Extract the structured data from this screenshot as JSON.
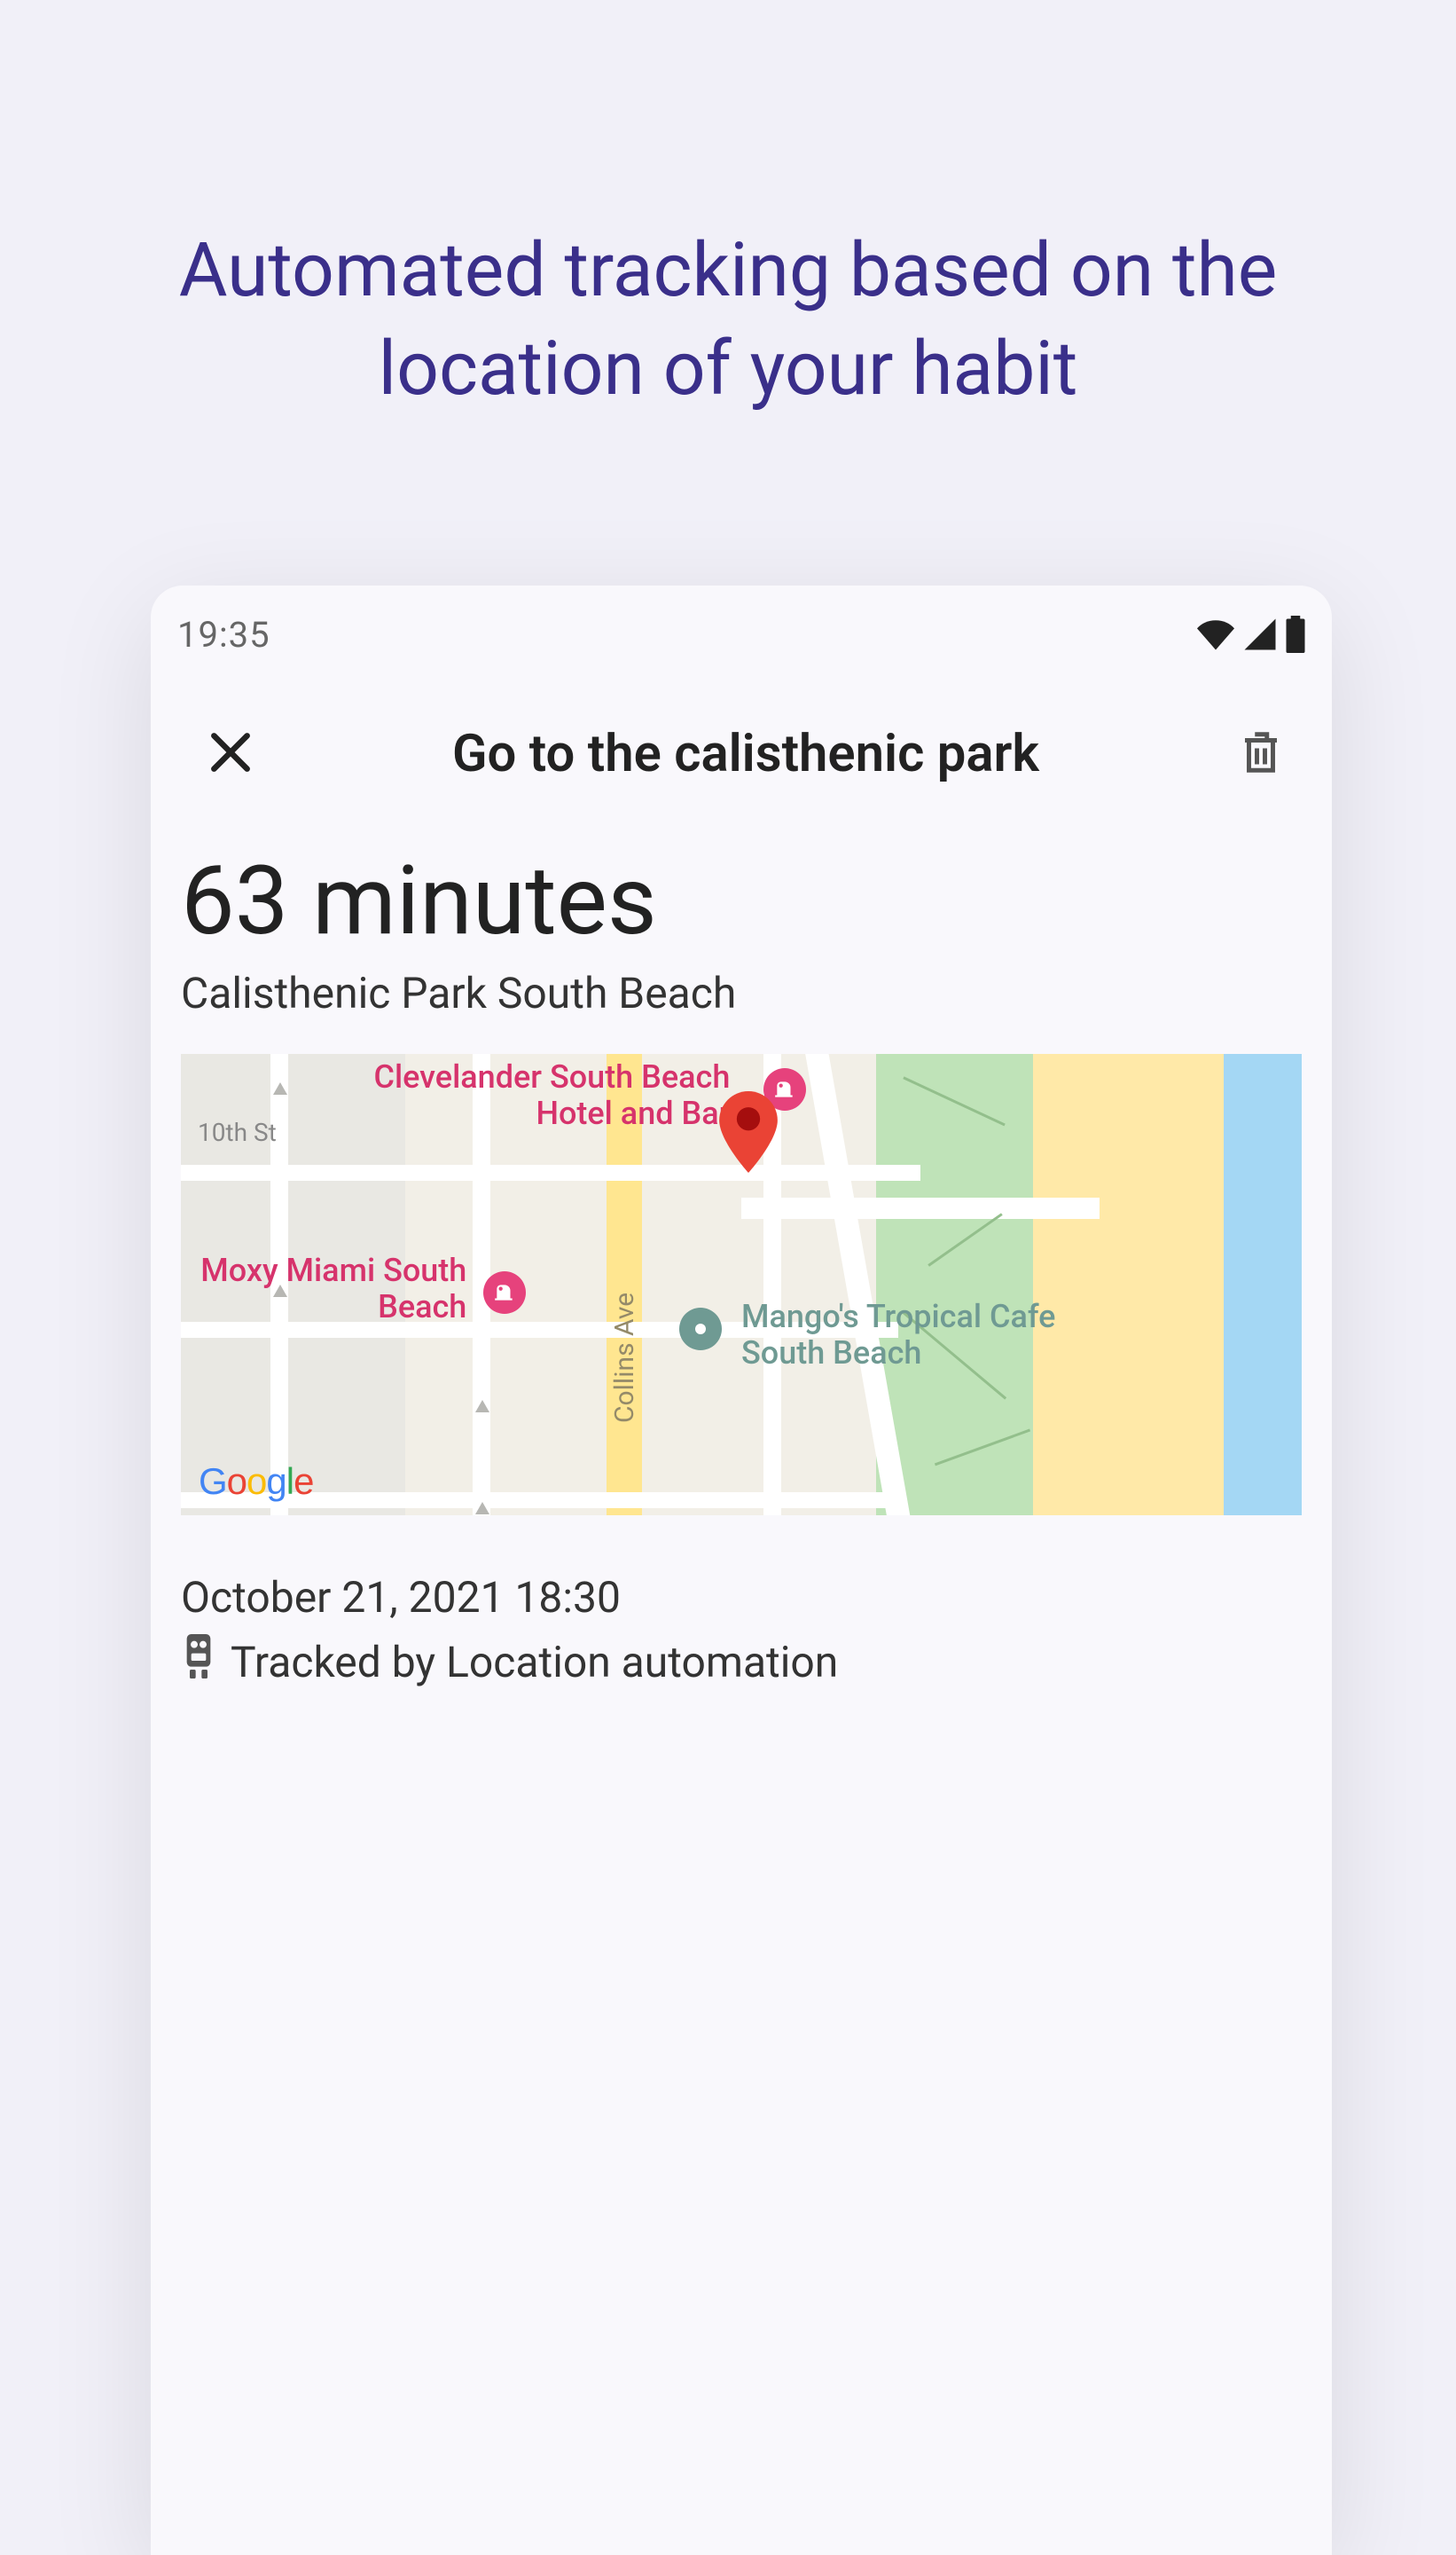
{
  "promo": {
    "heading": "Automated tracking based on the location of your habit"
  },
  "status_bar": {
    "time": "19:35"
  },
  "toolbar": {
    "title": "Go to the calisthenic park"
  },
  "details": {
    "duration": "63 minutes",
    "location_name": "Calisthenic Park South Beach",
    "timestamp": "October 21, 2021 18:30",
    "tracked_by": "Tracked by Location automation"
  },
  "map": {
    "attribution": "Google",
    "street_collins": "Collins Ave",
    "street_10th": "10th St",
    "pois": {
      "clevelander": "Clevelander South Beach Hotel and Bar",
      "moxy": "Moxy Miami South Beach",
      "mangos": "Mango's Tropical Cafe South Beach"
    }
  }
}
